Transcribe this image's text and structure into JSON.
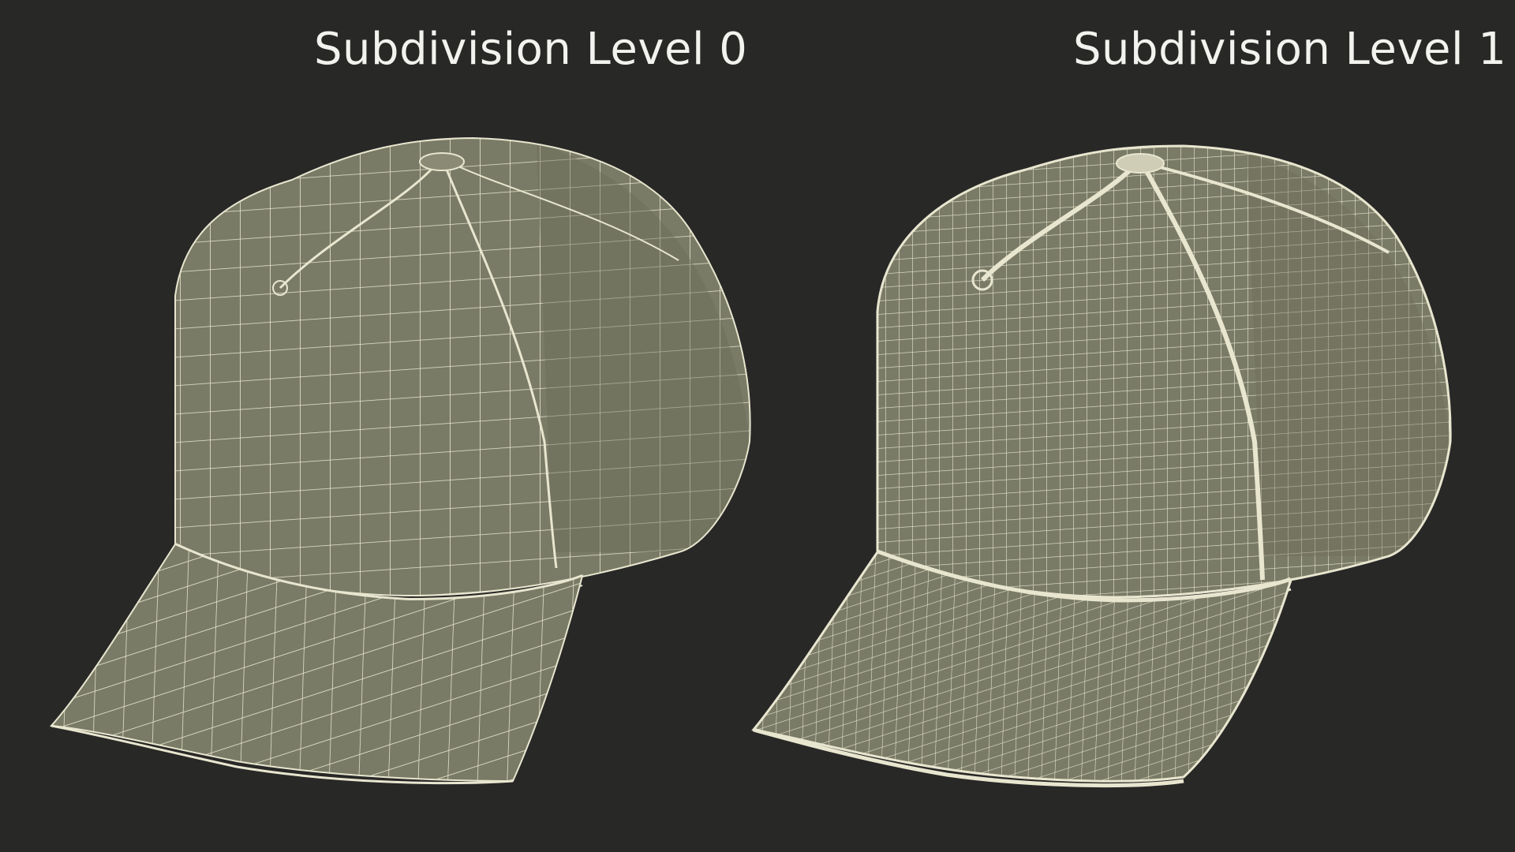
{
  "labels": {
    "left": "Subdivision Level 0",
    "right": "Subdivision Level 1"
  },
  "colors": {
    "background": "#282827",
    "mesh_fill": "#7a7b66",
    "wire": "#e8e6cf",
    "label": "#f2f2ee"
  }
}
